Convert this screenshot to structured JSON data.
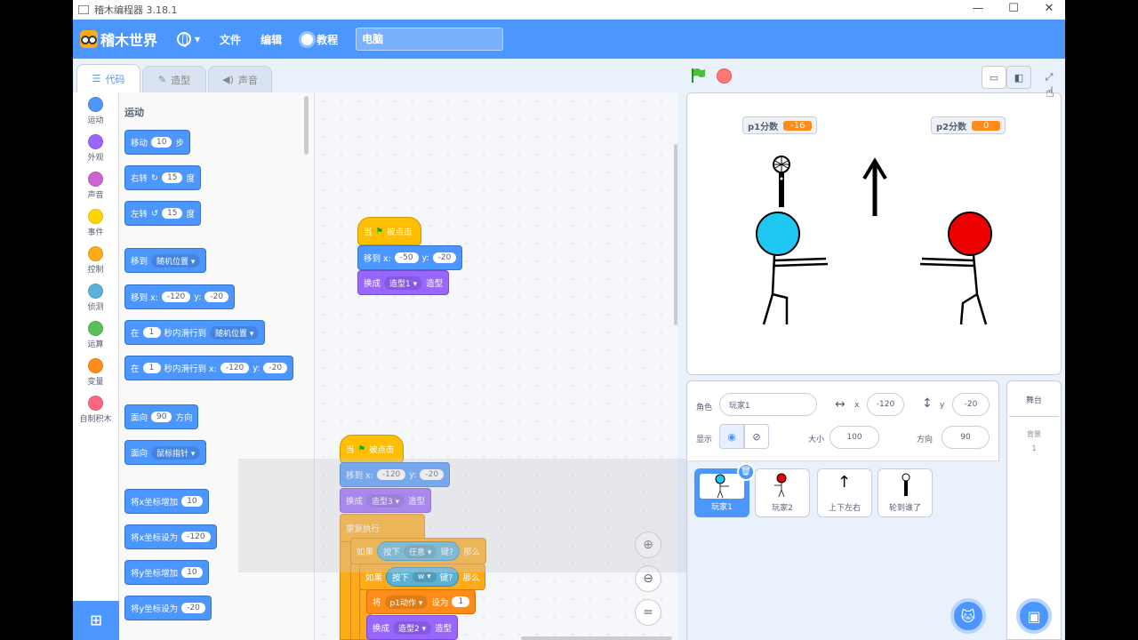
{
  "window": {
    "title": "稽木编程器 3.18.1",
    "minimize": "—",
    "maximize": "☐",
    "close": "✕"
  },
  "menubar": {
    "logo_text": "稽木世界",
    "language_icon": "globe-icon",
    "file": "文件",
    "edit": "编辑",
    "tutorial": "教程",
    "project_name": "电脑"
  },
  "tabs": [
    {
      "label": "代码",
      "active": true
    },
    {
      "label": "造型"
    },
    {
      "label": "声音"
    }
  ],
  "categories": [
    {
      "label": "运动",
      "color": "#4c97ff"
    },
    {
      "label": "外观",
      "color": "#9966ff"
    },
    {
      "label": "声音",
      "color": "#cf63cf"
    },
    {
      "label": "事件",
      "color": "#ffd500"
    },
    {
      "label": "控制",
      "color": "#ffab19"
    },
    {
      "label": "侦测",
      "color": "#5cb1d6"
    },
    {
      "label": "运算",
      "color": "#59c059"
    },
    {
      "label": "变量",
      "color": "#ff8c1a"
    },
    {
      "label": "自制积木",
      "color": "#ff6680"
    }
  ],
  "palette": {
    "title": "运动",
    "move": {
      "pre": "移动",
      "val": "10",
      "post": "步"
    },
    "turn_right": {
      "pre": "右转",
      "val": "15",
      "post": "度"
    },
    "turn_left": {
      "pre": "左转",
      "val": "15",
      "post": "度"
    },
    "goto_random": {
      "pre": "移到",
      "drop": "随机位置"
    },
    "goto_xy": {
      "pre": "移到 x:",
      "x": "-120",
      "y_label": "y:",
      "y": "-20"
    },
    "glide_random": {
      "pre": "在",
      "val": "1",
      "mid": "秒内滑行到",
      "drop": "随机位置"
    },
    "glide_xy": {
      "pre": "在",
      "val": "1",
      "mid": "秒内滑行到 x:",
      "x": "-120",
      "y_label": "y:",
      "y": "-20"
    },
    "point_dir": {
      "pre": "面向",
      "val": "90",
      "post": "方向"
    },
    "point_towards": {
      "pre": "面向",
      "drop": "鼠标指针"
    },
    "change_x": {
      "pre": "将x坐标增加",
      "val": "10"
    },
    "set_x": {
      "pre": "将x坐标设为",
      "val": "-120"
    },
    "change_y": {
      "pre": "将y坐标增加",
      "val": "10"
    },
    "set_y": {
      "pre": "将y坐标设为",
      "val": "-20"
    }
  },
  "script1": {
    "hat": {
      "pre": "当",
      "post": "被点击"
    },
    "goto": {
      "pre": "移到 x:",
      "x": "-50",
      "y_label": "y:",
      "y": "-20"
    },
    "costume": {
      "pre": "换成",
      "drop": "造型1",
      "post": "造型"
    }
  },
  "script2": {
    "hat": {
      "pre": "当",
      "post": "被点击"
    },
    "goto": {
      "pre": "移到 x:",
      "x": "-120",
      "y_label": "y:",
      "y": "-20"
    },
    "costume": {
      "pre": "换成",
      "drop": "造型3",
      "post": "造型"
    },
    "forever": "重复执行",
    "if1": {
      "pre": "如果",
      "sense_pre": "按下",
      "sense_drop": "任意",
      "sense_post": "键?",
      "post": "那么"
    },
    "if2": {
      "pre": "如果",
      "sense_pre": "按下",
      "sense_drop": "w",
      "sense_post": "键?",
      "post": "那么"
    },
    "setvar": {
      "pre": "将",
      "drop": "p1动作",
      "mid": "设为",
      "val": "1"
    },
    "costume2": {
      "pre": "换成",
      "drop": "造型2",
      "post": "造型"
    }
  },
  "zoom": {
    "in": "+",
    "out": "−",
    "reset": "="
  },
  "stage": {
    "p1_label": "p1分数",
    "p1_value": "-16",
    "p2_label": "p2分数",
    "p2_value": "0"
  },
  "sprite_info": {
    "sprite_label": "角色",
    "sprite_name": "玩家1",
    "x_label": "x",
    "x": "-120",
    "y_label": "y",
    "y": "-20",
    "show_label": "显示",
    "size_label": "大小",
    "size": "100",
    "dir_label": "方向",
    "dir": "90"
  },
  "sprites": [
    {
      "name": "玩家1",
      "selected": true
    },
    {
      "name": "玩家2"
    },
    {
      "name": "上下左右"
    },
    {
      "name": "轮到谁了"
    }
  ],
  "stage_pane": {
    "title": "舞台",
    "backdrops_label": "背景",
    "backdrops_count": "1"
  },
  "colors": {
    "accent": "#4c97ff",
    "monitor": "#ff8c1a",
    "player1": "#1ec8f0",
    "player2": "#ee0000"
  }
}
